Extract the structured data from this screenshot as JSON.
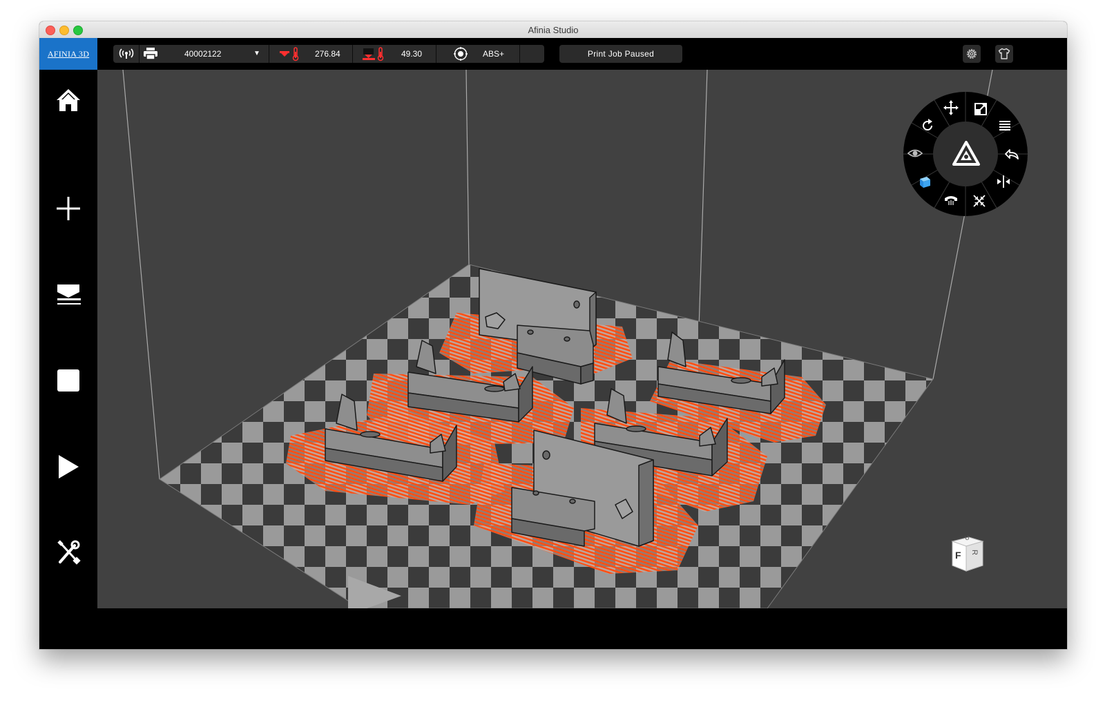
{
  "window": {
    "title": "Afinia Studio"
  },
  "topbar": {
    "logo_text": "AFINIA 3D",
    "printer_serial": "40002122",
    "dropdown_caret": "▼",
    "nozzle_temp": "276.84",
    "bed_temp": "49.30",
    "material": "ABS+",
    "print_status": "Print Job Paused"
  },
  "sidebar": {
    "items": [
      "home",
      "add",
      "layflat",
      "stop",
      "play",
      "tools"
    ]
  },
  "viewcube": {
    "front": "F",
    "up": "U",
    "right": "R"
  },
  "colors": {
    "accent_blue": "#1a73c9",
    "raft_orange": "#ff5a1f",
    "part_gray": "#8a8b8d",
    "viewport_bg": "#414141"
  },
  "icons": {
    "dial": [
      "move-icon",
      "scale-icon",
      "layers-icon",
      "undo-icon",
      "mirror-icon",
      "center-icon",
      "support-icon",
      "solid-view-icon",
      "visibility-icon",
      "rotate-icon",
      "afinia-logo-icon"
    ]
  }
}
